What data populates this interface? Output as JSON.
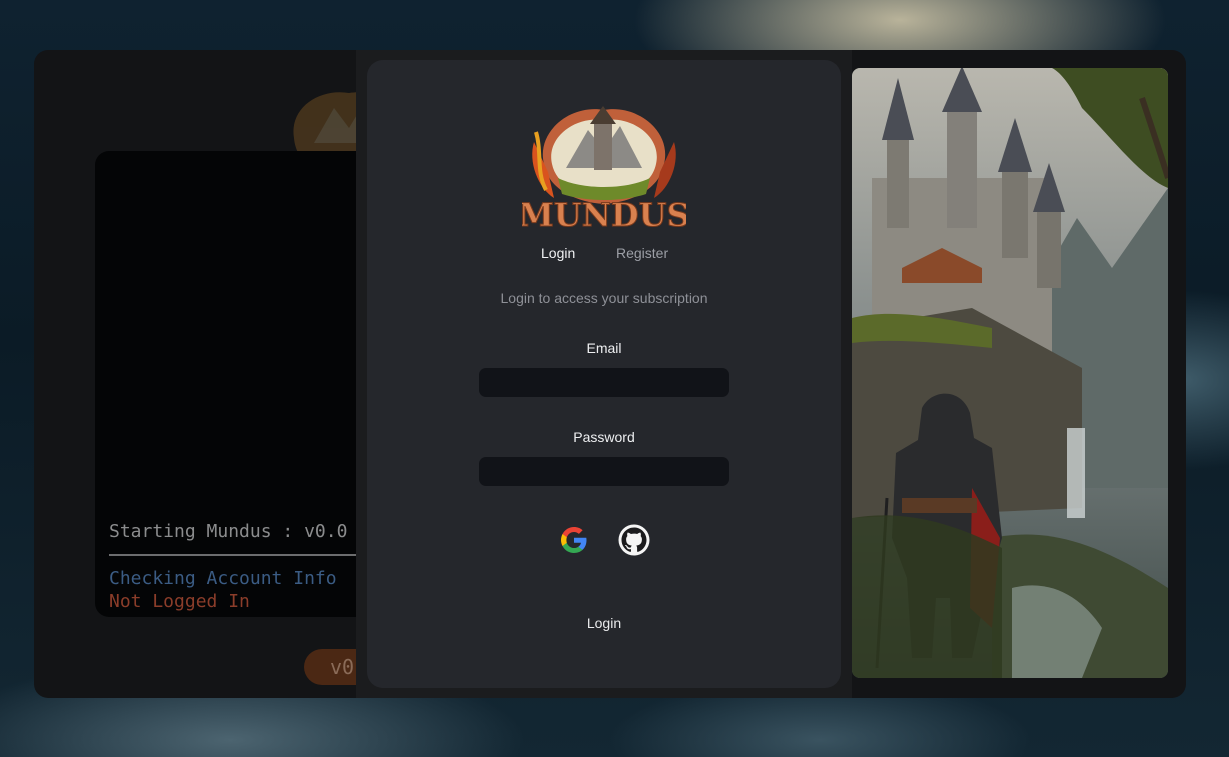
{
  "brand": {
    "logo_text": "MUNDUS"
  },
  "background_launcher": {
    "console": {
      "line1": "Starting Mundus : v0.0",
      "line2": "Checking Account Info",
      "line3": "Not Logged In"
    },
    "version_button_label": "v0"
  },
  "login_modal": {
    "tabs": {
      "login": "Login",
      "register": "Register"
    },
    "subtitle": "Login to access your subscription",
    "email": {
      "label": "Email",
      "value": ""
    },
    "password": {
      "label": "Password",
      "value": ""
    },
    "oauth": [
      {
        "icon": "google-icon"
      },
      {
        "icon": "github-icon"
      }
    ],
    "submit_label": "Login"
  },
  "colors": {
    "card": "#25272c",
    "input": "#111318",
    "console_blue": "#3b5c84",
    "console_red": "#8b3d2a"
  }
}
